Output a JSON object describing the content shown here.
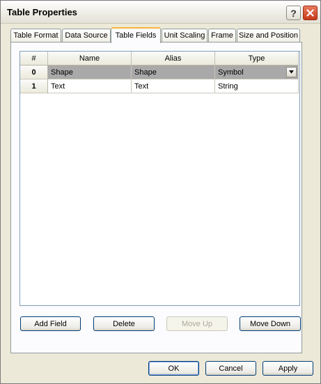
{
  "window": {
    "title": "Table Properties",
    "help_label": "?"
  },
  "tabs": [
    {
      "label": "Table Format",
      "active": false
    },
    {
      "label": "Data Source",
      "active": false
    },
    {
      "label": "Table Fields",
      "active": true
    },
    {
      "label": "Unit Scaling",
      "active": false
    },
    {
      "label": "Frame",
      "active": false
    },
    {
      "label": "Size and Position",
      "active": false
    }
  ],
  "fields_table": {
    "columns": [
      "#",
      "Name",
      "Alias",
      "Type"
    ],
    "rows": [
      {
        "index": "0",
        "name": "Shape",
        "alias": "Shape",
        "type": "Symbol",
        "selected": true
      },
      {
        "index": "1",
        "name": "Text",
        "alias": "Text",
        "type": "String",
        "selected": false
      }
    ]
  },
  "field_buttons": {
    "add": "Add Field",
    "delete": "Delete",
    "move_up": "Move Up",
    "move_down": "Move Down"
  },
  "footer": {
    "ok": "OK",
    "cancel": "Cancel",
    "apply": "Apply"
  },
  "colors": {
    "active_tab_accent": "#f7b33a",
    "selected_row": "#aaa9a9",
    "close_button": "#c6391a"
  }
}
